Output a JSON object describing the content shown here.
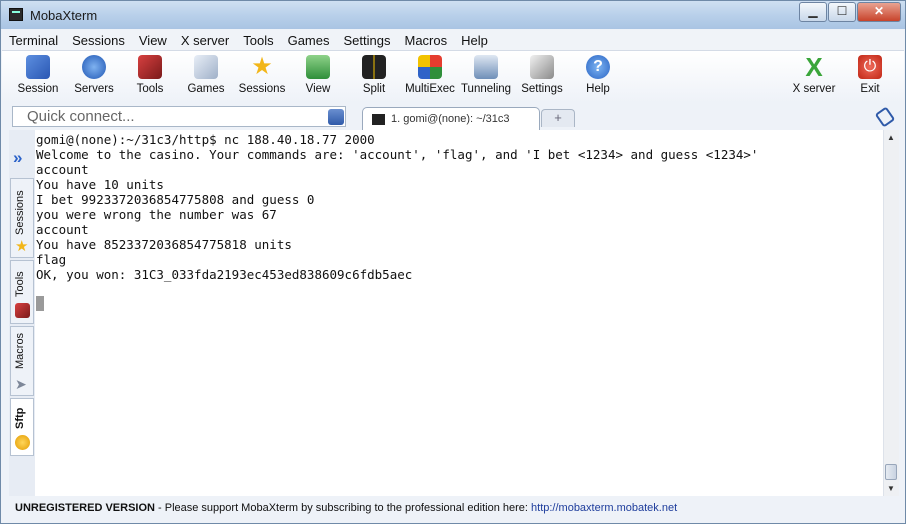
{
  "window": {
    "title": "MobaXterm",
    "buttons": {
      "minimize": "▁",
      "maximize": "☐",
      "close": "✕"
    }
  },
  "menu": [
    "Terminal",
    "Sessions",
    "View",
    "X server",
    "Tools",
    "Games",
    "Settings",
    "Macros",
    "Help"
  ],
  "toolbar": {
    "session": "Session",
    "servers": "Servers",
    "tools": "Tools",
    "games": "Games",
    "sessions": "Sessions",
    "view": "View",
    "split": "Split",
    "multiexec": "MultiExec",
    "tunneling": "Tunneling",
    "settings": "Settings",
    "help": "Help",
    "xserver": "X server",
    "exit": "Exit"
  },
  "quick_connect": {
    "placeholder": "Quick connect..."
  },
  "tabs": {
    "active_label": "1. gomi@(none): ~/31c3",
    "new_tab": "+"
  },
  "sidebar": {
    "sessions": "Sessions",
    "tools": "Tools",
    "macros": "Macros",
    "sftp": "Sftp"
  },
  "terminal": {
    "lines": [
      "gomi@(none):~/31c3/http$ nc 188.40.18.77 2000",
      "Welcome to the casino. Your commands are: 'account', 'flag', and 'I bet <1234> and guess <1234>'",
      "account",
      "You have 10 units",
      "I bet 9923372036854775808 and guess 0",
      "you were wrong the number was 67",
      "account",
      "You have 8523372036854775818 units",
      "flag",
      "OK, you won: 31C3_033fda2193ec453ed838609c6fdb5aec"
    ]
  },
  "status": {
    "unregistered": "UNREGISTERED VERSION",
    "message": " -  Please support MobaXterm by subscribing to the professional edition here: ",
    "link": "http://mobaxterm.mobatek.net"
  },
  "colors": {
    "accent": "#2b62c9",
    "close_button": "#c8432b",
    "terminal_bg": "#ffffff"
  }
}
